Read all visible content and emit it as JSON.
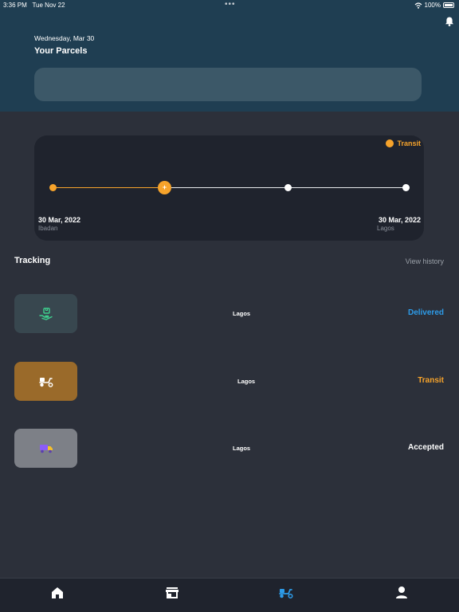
{
  "status_bar": {
    "time": "3:36 PM",
    "date": "Tue Nov 22",
    "dots": "•••",
    "battery": "100%"
  },
  "header": {
    "date": "Wednesday, Mar 30",
    "title": "Your Parcels",
    "search_value": ""
  },
  "route_card": {
    "status": "Transit",
    "status_color": "#f6a32b",
    "progress_marker": "+",
    "origin": {
      "date": "30 Mar, 2022",
      "city": "Ibadan"
    },
    "destination": {
      "date": "30 Mar, 2022",
      "city": "Lagos"
    }
  },
  "tracking": {
    "title": "Tracking",
    "view_history": "View history",
    "items": [
      {
        "city": "Lagos",
        "status": "Delivered",
        "status_color": "#2d9be8",
        "icon": "hand-package-icon",
        "box_color": "#38474f"
      },
      {
        "city": "Lagos",
        "status": "Transit",
        "status_color": "#f6a32b",
        "icon": "scooter-icon",
        "box_color": "#9a6a2a"
      },
      {
        "city": "Lagos",
        "status": "Accepted",
        "status_color": "#ffffff",
        "icon": "truck-icon",
        "box_color": "#7d8087"
      }
    ]
  },
  "nav": {
    "items": [
      {
        "icon": "home-icon",
        "active": false
      },
      {
        "icon": "store-icon",
        "active": false
      },
      {
        "icon": "scooter-icon",
        "active": true
      },
      {
        "icon": "profile-icon",
        "active": false
      }
    ],
    "active_color": "#2d9be8"
  }
}
